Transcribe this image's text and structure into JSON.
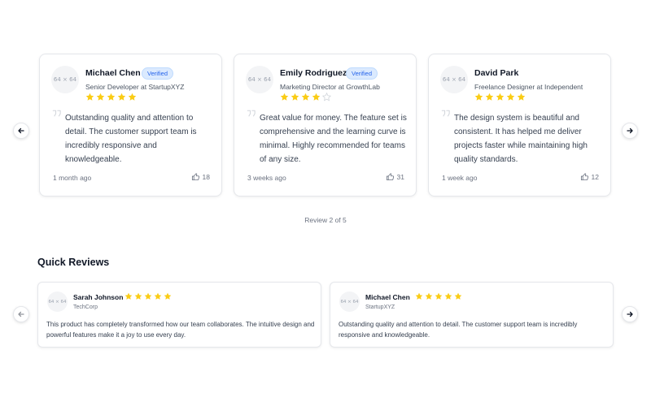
{
  "carousel": {
    "pager": "Review 2 of 5",
    "reviews": [
      {
        "avatar": "64 × 64",
        "name": "Michael Chen",
        "badge": "Verified",
        "role": "Senior Developer at StartupXYZ",
        "rating": 5,
        "text": "Outstanding quality and attention to detail. The customer support team is incredibly responsive and knowledgeable.",
        "time": "1 month ago",
        "likes": "18"
      },
      {
        "avatar": "64 × 64",
        "name": "Emily Rodriguez",
        "badge": "Verified",
        "role": "Marketing Director at GrowthLab",
        "rating": 4,
        "text": "Great value for money. The feature set is comprehensive and the learning curve is minimal. Highly recommended for teams of any size.",
        "time": "3 weeks ago",
        "likes": "31"
      },
      {
        "avatar": "64 × 64",
        "name": "David Park",
        "role": "Freelance Designer at Independent",
        "rating": 5,
        "text": "The design system is beautiful and consistent. It has helped me deliver projects faster while maintaining high quality standards.",
        "time": "1 week ago",
        "likes": "12"
      }
    ]
  },
  "quick": {
    "title": "Quick Reviews",
    "reviews": [
      {
        "avatar": "64 × 64",
        "name": "Sarah Johnson",
        "company": "TechCorp",
        "rating": 5,
        "text": "This product has completely transformed how our team collaborates. The intuitive design and powerful features make it a joy to use every day."
      },
      {
        "avatar": "64 × 64",
        "name": "Michael Chen",
        "company": "StartupXYZ",
        "rating": 5,
        "text": "Outstanding quality and attention to detail. The customer support team is incredibly responsive and knowledgeable."
      }
    ]
  },
  "colors": {
    "star": "#facc15",
    "star_empty": "#d1d5db",
    "badge_bg": "#dbeafe",
    "badge_text": "#2563eb"
  },
  "icons": {
    "prev": "arrow-left-icon",
    "next": "arrow-right-icon",
    "quote": "quote-icon",
    "like": "thumbs-up-icon",
    "star": "star-icon"
  }
}
